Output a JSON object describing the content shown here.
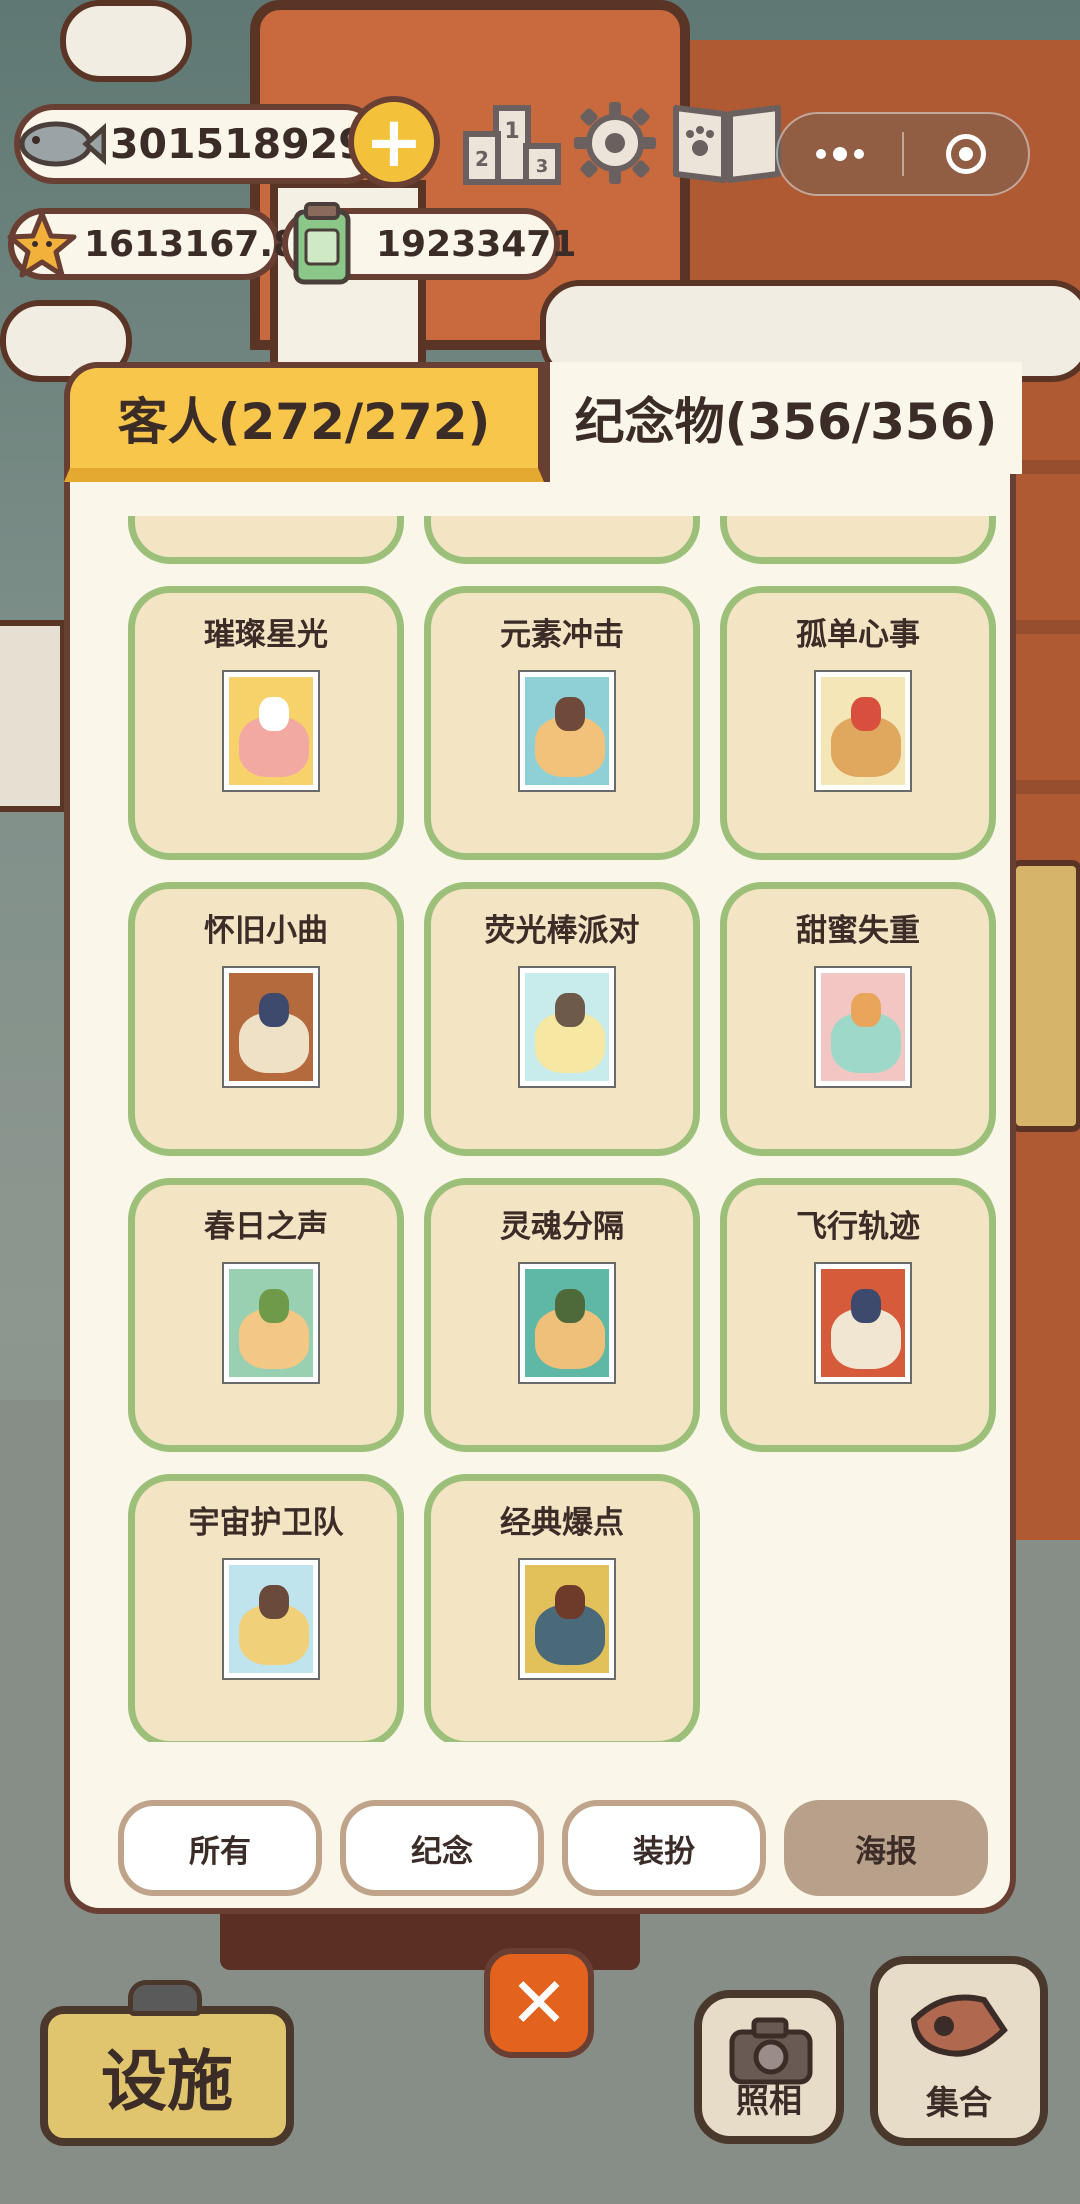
{
  "currencies": {
    "fish": "3015189293",
    "stars": "1613167.8",
    "tickets": "19233471"
  },
  "tabs": {
    "guests": "客人(272/272)",
    "souvenirs": "纪念物(356/356)"
  },
  "items": [
    {
      "name": "璀璨星光",
      "colors": [
        "#f7d26a",
        "#f2a9a2",
        "#ffffff"
      ]
    },
    {
      "name": "元素冲击",
      "colors": [
        "#8fd0d6",
        "#f2c27a",
        "#6f4a3a"
      ]
    },
    {
      "name": "孤单心事",
      "colors": [
        "#f4e6b6",
        "#e0a75e",
        "#d94f3e"
      ]
    },
    {
      "name": "怀旧小曲",
      "colors": [
        "#b56a3e",
        "#eee1c6",
        "#3d4a6d"
      ]
    },
    {
      "name": "荧光棒派对",
      "colors": [
        "#c8ecec",
        "#f6e7a2",
        "#6e5a4a"
      ]
    },
    {
      "name": "甜蜜失重",
      "colors": [
        "#f2c6c2",
        "#9ed8c9",
        "#e9a55a"
      ]
    },
    {
      "name": "春日之声",
      "colors": [
        "#9ad0b2",
        "#f3c784",
        "#6f9a4a"
      ]
    },
    {
      "name": "灵魂分隔",
      "colors": [
        "#5fb7a6",
        "#efc07a",
        "#4f6a3a"
      ]
    },
    {
      "name": "飞行轨迹",
      "colors": [
        "#d65b3a",
        "#f1e6d2",
        "#3d4a6d"
      ]
    },
    {
      "name": "宇宙护卫队",
      "colors": [
        "#bfe4ee",
        "#f1d07a",
        "#6a4a3a"
      ]
    },
    {
      "name": "经典爆点",
      "colors": [
        "#e3c15a",
        "#4a6a7a",
        "#6e3a2a"
      ]
    }
  ],
  "filters": [
    {
      "label": "所有",
      "active": false
    },
    {
      "label": "纪念",
      "active": false
    },
    {
      "label": "装扮",
      "active": false
    },
    {
      "label": "海报",
      "active": true
    }
  ],
  "bottom": {
    "facility": "设施",
    "photo": "照相",
    "gather": "集合"
  },
  "colors": {
    "card_border": "#9cc07a",
    "card_fill": "#f3e4c4",
    "tab_active": "#f7c64a",
    "filter_active": "#b8a08a"
  }
}
